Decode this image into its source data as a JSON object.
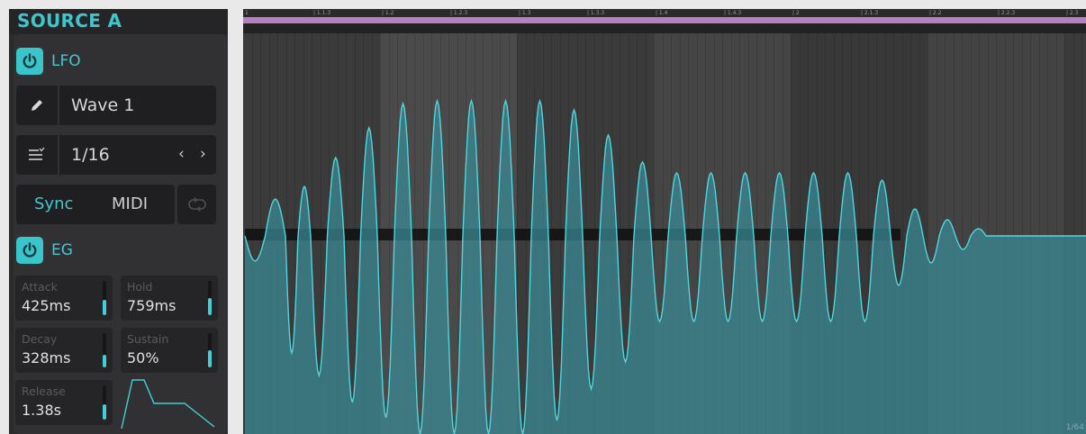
{
  "panel": {
    "title": "SOURCE A",
    "lfo": {
      "label": "LFO",
      "wave_name": "Wave 1",
      "rate": "1/16",
      "prev_symbol": "‹",
      "next_symbol": "›",
      "sync_label": "Sync",
      "midi_label": "MIDI"
    },
    "eg": {
      "label": "EG",
      "params": [
        {
          "label": "Attack",
          "value": "425ms",
          "level": 0.45
        },
        {
          "label": "Hold",
          "value": "759ms",
          "level": 0.5
        },
        {
          "label": "Decay",
          "value": "328ms",
          "level": 0.38
        },
        {
          "label": "Sustain",
          "value": "50%",
          "level": 0.5
        },
        {
          "label": "Release",
          "value": "1.38s",
          "level": 0.45
        }
      ]
    }
  },
  "editor": {
    "ruler_ticks": [
      "1",
      "1.1.3",
      "1.2",
      "1.2.3",
      "1.3",
      "1.3.3",
      "1.4",
      "1.4.3",
      "2",
      "2.1.3",
      "2.2",
      "2.2.3",
      "2.3"
    ],
    "grid_label": "1/64"
  },
  "colors": {
    "accent": "#39c5cb",
    "loop_bar": "#b47fc3",
    "wave_stroke": "#4fd6df",
    "wave_fill": "#3a8a96"
  },
  "icons": [
    "power-icon",
    "pencil-icon",
    "list-icon",
    "chevron-left-icon",
    "chevron-right-icon",
    "loop-icon"
  ]
}
